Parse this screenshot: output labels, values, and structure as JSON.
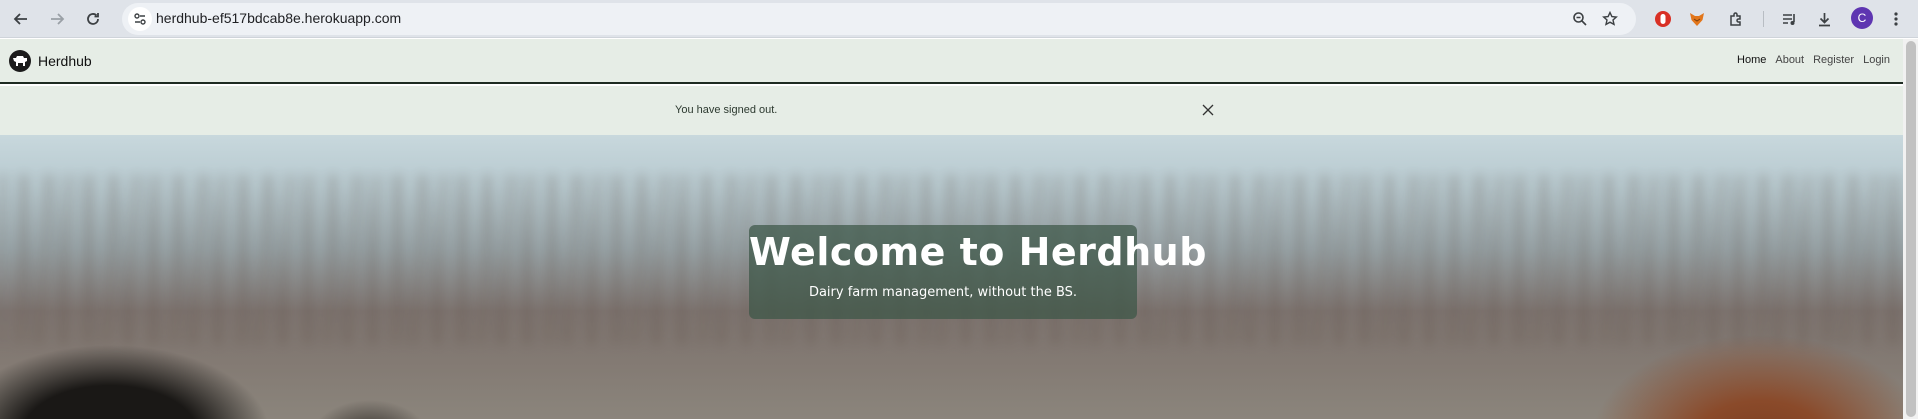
{
  "browser": {
    "url": "herdhub-ef517bdcab8e.herokuapp.com",
    "profile_initial": "C",
    "icons": [
      "back-icon",
      "forward-icon",
      "reload-icon",
      "site-info-icon",
      "zoom-icon",
      "bookmark-star-icon",
      "extension-shield-icon",
      "extension-fox-icon",
      "extensions-puzzle-icon",
      "media-control-icon",
      "downloads-icon",
      "menu-icon"
    ]
  },
  "nav": {
    "brand": "Herdhub",
    "links": [
      "Home",
      "About",
      "Register",
      "Login"
    ]
  },
  "alert": {
    "message": "You have signed out."
  },
  "hero": {
    "title": "Welcome to Herdhub",
    "subtitle": "Dairy farm management, without the BS."
  },
  "colors": {
    "nav_bg": "#e6ede6",
    "nav_border": "#1e2b22",
    "hero_card_bg": "#3c5646",
    "profile_avatar": "#5e35b1"
  }
}
